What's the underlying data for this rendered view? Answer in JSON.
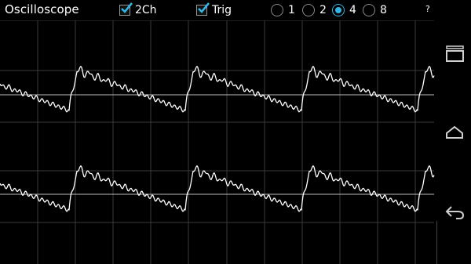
{
  "app": {
    "title": "Oscilloscope"
  },
  "toolbar": {
    "two_channel": {
      "label": "2Ch",
      "checked": true
    },
    "trigger": {
      "label": "Trig",
      "checked": true
    },
    "timebase_options": [
      "1",
      "2",
      "4",
      "8"
    ],
    "timebase_selected": "4",
    "help_label": "?"
  },
  "scope": {
    "background": "#000000",
    "grid_color": "#3a3a3a",
    "trace_color": "#ffffff",
    "baseline_color": "#bdbdbd",
    "channels": 2
  },
  "navbar": {
    "icons": [
      "recent-apps-icon",
      "home-icon",
      "back-icon"
    ]
  },
  "colors": {
    "accent": "#33b5e5"
  }
}
